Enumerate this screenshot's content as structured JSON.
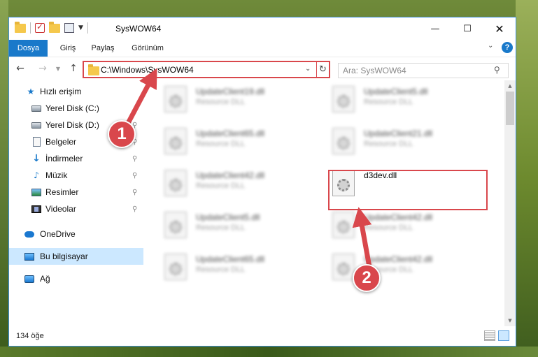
{
  "window": {
    "title": "SysWOW64",
    "controls": {
      "minimize": "—",
      "maximize": "☐",
      "close": "✕"
    }
  },
  "ribbon": {
    "tabs": [
      "Dosya",
      "Giriş",
      "Paylaş",
      "Görünüm"
    ],
    "help": "?"
  },
  "navigation": {
    "back": "←",
    "forward": "→",
    "recent": "⌄",
    "up": "↑",
    "address": "C:\\Windows\\SysWOW64",
    "refresh": "↻",
    "search_placeholder": "Ara: SysWOW64"
  },
  "sidebar": {
    "quick_access": "Hızlı erişim",
    "items": [
      {
        "label": "Yerel Disk (C:)",
        "icon": "drive-icon"
      },
      {
        "label": "Yerel Disk (D:)",
        "icon": "drive-icon"
      },
      {
        "label": "Belgeler",
        "icon": "documents-icon"
      },
      {
        "label": "İndirmeler",
        "icon": "downloads-icon"
      },
      {
        "label": "Müzik",
        "icon": "music-icon"
      },
      {
        "label": "Resimler",
        "icon": "pictures-icon"
      },
      {
        "label": "Videolar",
        "icon": "videos-icon"
      }
    ],
    "onedrive": "OneDrive",
    "this_pc": "Bu bilgisayar",
    "network": "Ağ"
  },
  "files": [
    {
      "name": "UpdateClient19.dll",
      "type": "Resource DLL"
    },
    {
      "name": "UpdateClient5.dll",
      "type": "Resource DLL"
    },
    {
      "name": "UpdateClient65.dll",
      "type": "Resource DLL"
    },
    {
      "name": "UpdateClient21.dll",
      "type": "Resource DLL"
    },
    {
      "name": "UpdateClient42.dll",
      "type": "Resource DLL"
    },
    {
      "name": "d3dev.dll",
      "type": ""
    },
    {
      "name": "UpdateClient5.dll",
      "type": "Resource DLL"
    },
    {
      "name": "UpdateClient42.dll",
      "type": "Resource DLL"
    },
    {
      "name": "UpdateClient65.dll",
      "type": "Resource DLL"
    },
    {
      "name": "UpdateClient42.dll",
      "type": "Resource DLL"
    }
  ],
  "status": {
    "item_count": "134 öğe"
  },
  "annotations": {
    "step1": "1",
    "step2": "2",
    "highlight_color": "#d9474c"
  },
  "colors": {
    "accent": "#1979ca",
    "selection": "#cce8ff"
  }
}
